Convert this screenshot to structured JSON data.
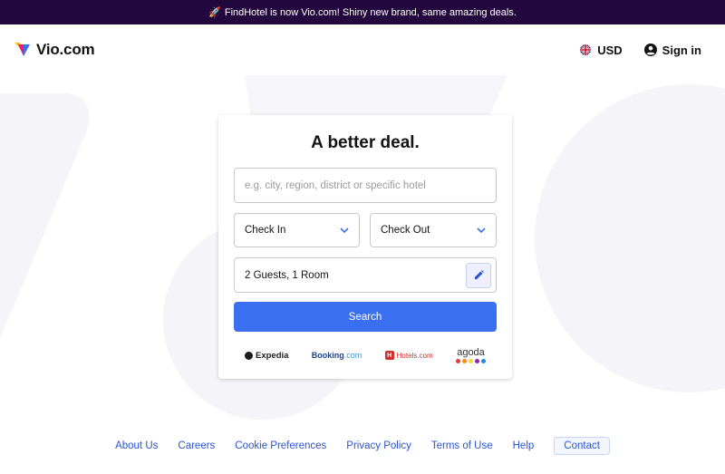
{
  "banner": {
    "icon": "rocket-icon",
    "text": "FindHotel is now Vio.com! Shiny new brand, same amazing deals."
  },
  "header": {
    "logo_text": "Vio.com",
    "currency_label": "USD",
    "currency_flag": "uk-flag-icon",
    "signin_label": "Sign in"
  },
  "search_card": {
    "title": "A better deal.",
    "destination_placeholder": "e.g. city, region, district or specific hotel",
    "checkin_label": "Check In",
    "checkout_label": "Check Out",
    "guests_value": "2 Guests, 1 Room",
    "search_button": "Search"
  },
  "partners": {
    "expedia": "Expedia",
    "booking_main": "Booking",
    "booking_suffix": ".com",
    "hotels": "Hotels.com",
    "agoda": "agoda"
  },
  "footer": {
    "links": [
      "About Us",
      "Careers",
      "Cookie Preferences",
      "Privacy Policy",
      "Terms of Use",
      "Help",
      "Contact"
    ]
  },
  "colors": {
    "banner_bg": "#22083c",
    "accent": "#3a6ff1",
    "link": "#2c54d0",
    "background_shape": "#f4f4f9"
  }
}
